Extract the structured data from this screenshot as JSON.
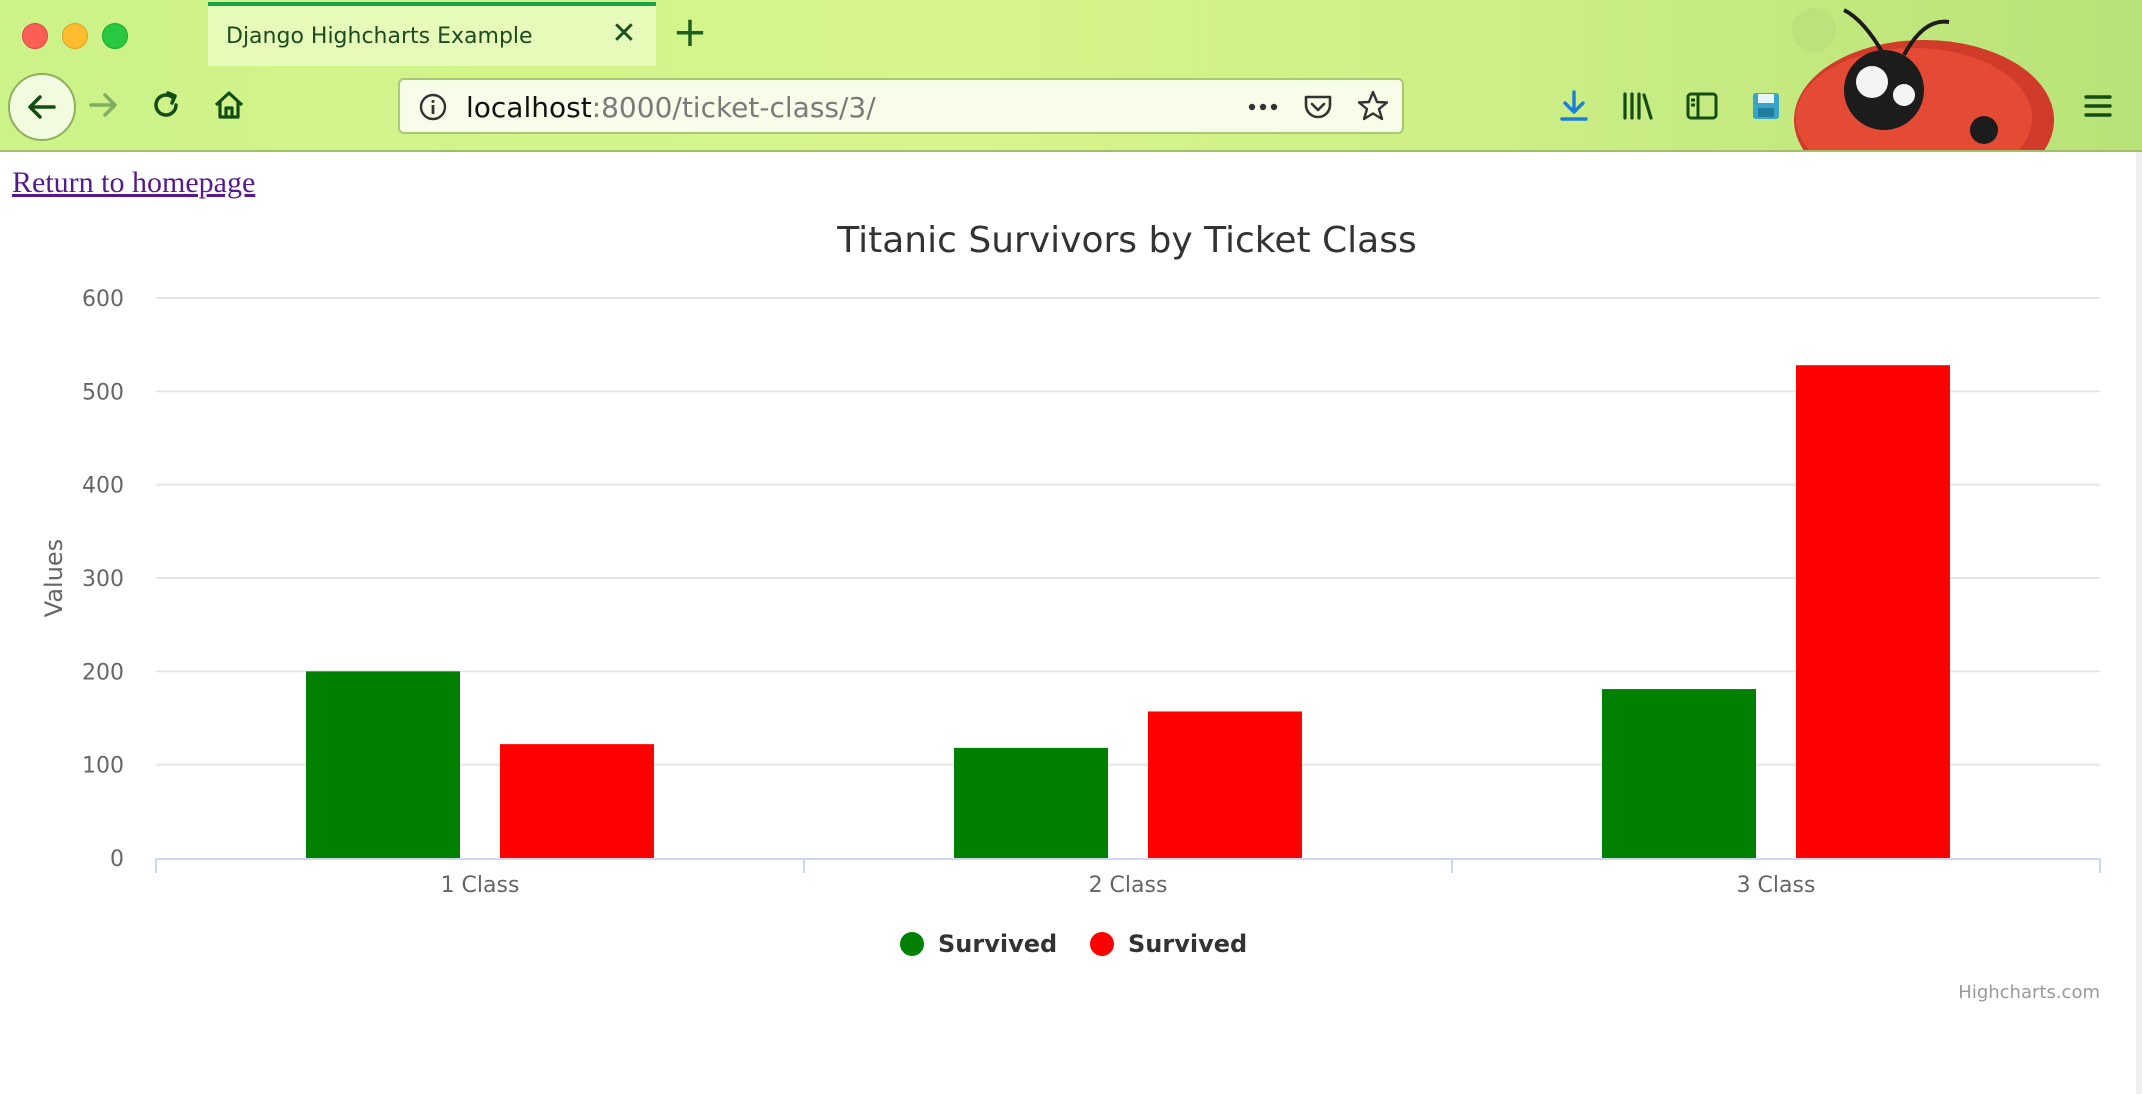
{
  "browser": {
    "tab_title": "Django Highcharts Example",
    "url_host": "localhost",
    "url_path": ":8000/ticket-class/3/"
  },
  "page": {
    "home_link": "Return to homepage"
  },
  "chart_data": {
    "type": "bar",
    "title": "Titanic Survivors by Ticket Class",
    "ylabel": "Values",
    "xlabel": "",
    "categories": [
      "1 Class",
      "2 Class",
      "3 Class"
    ],
    "ylim": [
      0,
      600
    ],
    "yticks": [
      0,
      100,
      200,
      300,
      400,
      500,
      600
    ],
    "grid": true,
    "legend_position": "bottom-center",
    "series": [
      {
        "name": "Survived",
        "color": "#008000",
        "values": [
          200,
          118,
          181
        ]
      },
      {
        "name": "Survived",
        "color": "#ff0000",
        "values": [
          122,
          157,
          528
        ]
      }
    ],
    "credits": "Highcharts.com"
  }
}
